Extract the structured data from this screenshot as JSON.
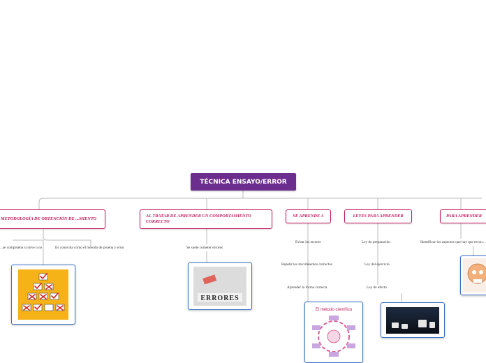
{
  "root": {
    "label": "TÉCNICA ENSAYO/ERROR"
  },
  "branches": [
    {
      "label": "METODOLOGÍA DE OBTENCIÓN DE ...MIENTO"
    },
    {
      "label": "AL TRATAR DE APRENDER UN COMPORTAMIENTO CORRECTO"
    },
    {
      "label": "SE APRENDE A"
    },
    {
      "label": "LEYES PARA APRENDER"
    },
    {
      "label": "PARA APRENDER"
    }
  ],
  "leaves": {
    "metodologia": [
      "...se comprueba si sirve o no",
      "Es conocida como el método de prueba y error"
    ],
    "al_tratar": [
      "Se suele cometer errores"
    ],
    "se_aprende": [
      "Evitar los errores",
      "Repetir los movimientos correctos",
      "Aprender la forma correcta"
    ],
    "leyes": [
      "Ley de preparación",
      "Ley del ejercicio",
      "Ley de efecto"
    ],
    "para_aprender": [
      "Identificar los aspectos que hay que recon..."
    ]
  },
  "images": {
    "errores_word": "ERRORES",
    "metodo_title": "El método científico"
  },
  "colors": {
    "root_bg": "#6b2d8e",
    "branch_border": "#c2185b",
    "image_border": "#3a72c5",
    "connector": "#b9b9b9"
  }
}
